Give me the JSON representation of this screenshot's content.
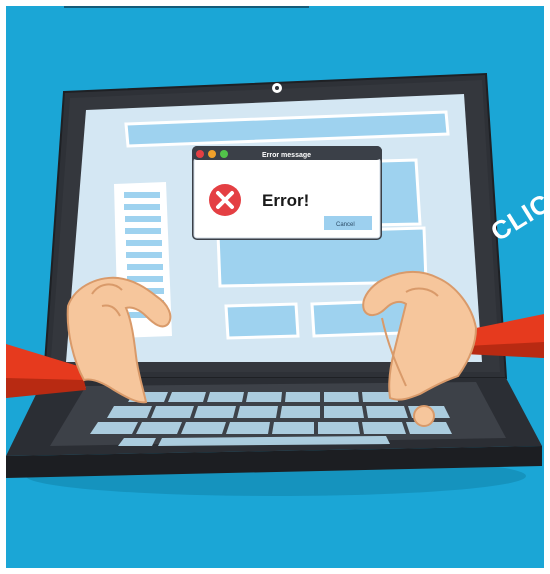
{
  "dialog": {
    "title": "Error message",
    "message": "Error!",
    "cancel_label": "Cancel"
  },
  "sticker": {
    "text": "CLICK"
  },
  "colors": {
    "background": "#1ba6d6",
    "laptop_body": "#2e3137",
    "screen": "#d4e7f3",
    "dialog_titlebar": "#3b4048",
    "error_red": "#e43f43",
    "button_blue": "#9dd0ef",
    "skin": "#f6c69c",
    "sleeve": "#e63a1e"
  },
  "icons": {
    "dialog_error": "error-x-circle-icon",
    "camera": "webcam-icon"
  }
}
